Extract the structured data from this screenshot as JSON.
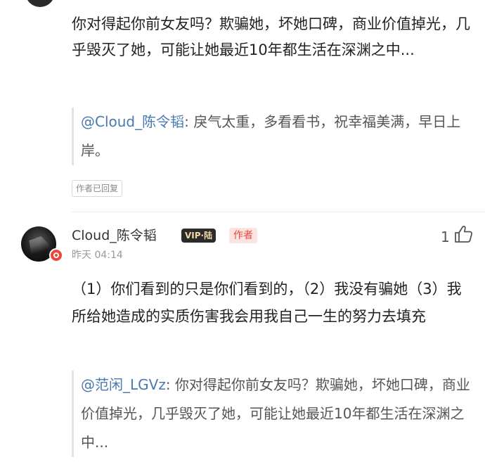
{
  "prev_comment": {
    "text": "你对得起你前女友吗？欺骗她，坏她口碑，商业价值掉光，几乎毁灭了她，可能让她最近10年都生活在深渊之中...",
    "quote": {
      "mention": "@Cloud_陈令韬",
      "text": ": 戾气太重，多看看书，祝幸福美满，早日上岸。"
    },
    "tag": "作者已回复"
  },
  "comment": {
    "username": "Cloud_陈令韬",
    "vip_badge": "VIP·陆",
    "author_tag": "作者",
    "timestamp": "昨天 04:14",
    "likes": "1",
    "text": "（1）你们看到的只是你们看到的，（2）我没有骗她（3）我所给她造成的实质伤害我会用我自己一生的努力去填充",
    "quote": {
      "mention": "@范闲_LGVz",
      "text": ": 你对得起你前女友吗？欺骗她，坏她口碑，商业价值掉光，几乎毁灭了她，可能让她最近10年都生活在深渊之中..."
    }
  },
  "colors": {
    "mention": "#4a78b0",
    "author_tag_text": "#e5483a",
    "author_tag_bg": "#fbe3e1",
    "vip_badge_bg": "#2b2b2b"
  },
  "icons": [
    "avatar",
    "weibo-badge-icon",
    "like-icon"
  ]
}
